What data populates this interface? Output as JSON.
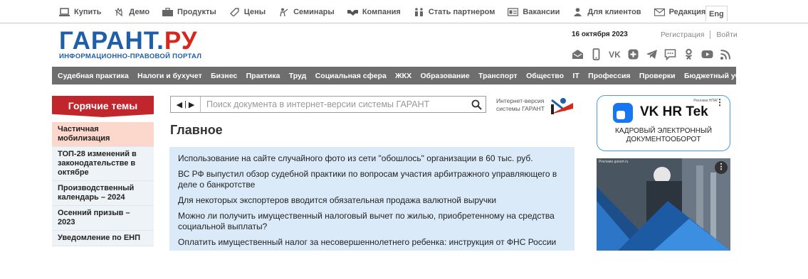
{
  "topbar": {
    "items": [
      {
        "label": "Купить",
        "icon": "laptop-icon"
      },
      {
        "label": "Демо",
        "icon": "hand-icon"
      },
      {
        "label": "Продукты",
        "icon": "briefcase-icon"
      },
      {
        "label": "Цены",
        "icon": "tag-icon"
      },
      {
        "label": "Семинары",
        "icon": "presenter-icon"
      },
      {
        "label": "Компания",
        "icon": "handshake-icon"
      },
      {
        "label": "Стать партнером",
        "icon": "partners-icon"
      },
      {
        "label": "Вакансии",
        "icon": "id-card-icon"
      },
      {
        "label": "Для клиентов",
        "icon": "person-icon"
      },
      {
        "label": "Редакция",
        "icon": "envelope-icon"
      }
    ],
    "lang": "Eng"
  },
  "header": {
    "logo_main": "ГАРАНТ",
    "logo_dot": ".",
    "logo_ru": "РУ",
    "logo_sub": "ИНФОРМАЦИОННО-ПРАВОВОЙ ПОРТАЛ",
    "date": "16 октября 2023",
    "register": "Регистрация",
    "login": "Войти",
    "social": [
      "mail-icon",
      "mobile-icon",
      "vk-icon",
      "ok-plus-icon",
      "telegram-icon",
      "chat-icon",
      "odnoklassniki-icon",
      "youtube-icon",
      "rss-icon"
    ]
  },
  "nav": {
    "items": [
      "Судебная практика",
      "Налоги и бухучет",
      "Бизнес",
      "Практика",
      "Труд",
      "Социальная сфера",
      "ЖКХ",
      "Образование",
      "Транспорт",
      "Общество",
      "IT",
      "Профессия",
      "Проверки",
      "Бюджетный учет"
    ]
  },
  "hot": {
    "title": "Горячие темы",
    "items": [
      "Частичная мобилизация",
      "ТОП-28 изменений в законодательстве в октябре",
      "Производственный календарь – 2024",
      "Осенний призыв – 2023",
      "Уведомление по ЕНП"
    ]
  },
  "search": {
    "placeholder": "Поиск документа в интернет-версии системы ГАРАНТ",
    "promo_line1": "Интернет-версия",
    "promo_line2": "системы ГАРАНТ"
  },
  "main": {
    "title": "Главное",
    "news": [
      "Использование на сайте случайного фото из сети \"обошлось\" организации в 60 тыс. руб.",
      "ВС РФ выпустил обзор судебной практики по вопросам участия арбитражного управляющего в деле о банкротстве",
      "Для некоторых экспортеров вводится обязательная продажа валютной выручки",
      "Можно ли получить имущественный налоговый вычет по жилью, приобретенному на средства социальной выплаты?",
      "Оплатить имущественный налог за несовершеннолетнего ребенка: инструкция от ФНС России"
    ]
  },
  "ads": {
    "ad1_label": "Реклама НПАГ",
    "ad1_name": "VK HR Tek",
    "ad1_line1": "КАДРОВЫЙ ЭЛЕКТРОННЫЙ",
    "ad1_line2": "ДОКУМЕНТООБОРОТ",
    "ad2_label": "Реклама garant.ru"
  },
  "colors": {
    "brand_blue": "#1f5ea8",
    "brand_red": "#d9261c",
    "nav_bg": "#6e6e6e",
    "hot_red": "#c0262b",
    "news_bg": "#dbeaf9"
  }
}
